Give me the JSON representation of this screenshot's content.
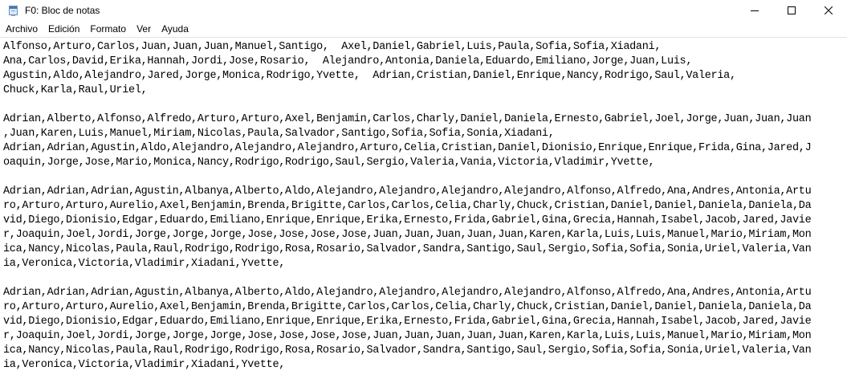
{
  "window": {
    "title": "F0: Bloc de notas",
    "icon": "notepad-icon"
  },
  "menu": [
    "Archivo",
    "Edición",
    "Formato",
    "Ver",
    "Ayuda"
  ],
  "document": {
    "lines": [
      "Alfonso,Arturo,Carlos,Juan,Juan,Juan,Manuel,Santigo,  Axel,Daniel,Gabriel,Luis,Paula,Sofia,Sofia,Xiadani,",
      "Ana,Carlos,David,Erika,Hannah,Jordi,Jose,Rosario,  Alejandro,Antonia,Daniela,Eduardo,Emiliano,Jorge,Juan,Luis,",
      "Agustin,Aldo,Alejandro,Jared,Jorge,Monica,Rodrigo,Yvette,  Adrian,Cristian,Daniel,Enrique,Nancy,Rodrigo,Saul,Valeria,",
      "Chuck,Karla,Raul,Uriel,",
      "",
      "Adrian,Alberto,Alfonso,Alfredo,Arturo,Arturo,Axel,Benjamin,Carlos,Charly,Daniel,Daniela,Ernesto,Gabriel,Joel,Jorge,Juan,Juan,Juan",
      ",Juan,Karen,Luis,Manuel,Miriam,Nicolas,Paula,Salvador,Santigo,Sofia,Sofia,Sonia,Xiadani,",
      "Adrian,Adrian,Agustin,Aldo,Alejandro,Alejandro,Alejandro,Arturo,Celia,Cristian,Daniel,Dionisio,Enrique,Enrique,Frida,Gina,Jared,J",
      "oaquin,Jorge,Jose,Mario,Monica,Nancy,Rodrigo,Rodrigo,Saul,Sergio,Valeria,Vania,Victoria,Vladimir,Yvette,",
      "",
      "Adrian,Adrian,Adrian,Agustin,Albanya,Alberto,Aldo,Alejandro,Alejandro,Alejandro,Alejandro,Alfonso,Alfredo,Ana,Andres,Antonia,Artu",
      "ro,Arturo,Arturo,Aurelio,Axel,Benjamin,Brenda,Brigitte,Carlos,Carlos,Celia,Charly,Chuck,Cristian,Daniel,Daniel,Daniela,Daniela,Da",
      "vid,Diego,Dionisio,Edgar,Eduardo,Emiliano,Enrique,Enrique,Erika,Ernesto,Frida,Gabriel,Gina,Grecia,Hannah,Isabel,Jacob,Jared,Javie",
      "r,Joaquin,Joel,Jordi,Jorge,Jorge,Jorge,Jose,Jose,Jose,Jose,Juan,Juan,Juan,Juan,Juan,Karen,Karla,Luis,Luis,Manuel,Mario,Miriam,Mon",
      "ica,Nancy,Nicolas,Paula,Raul,Rodrigo,Rodrigo,Rosa,Rosario,Salvador,Sandra,Santigo,Saul,Sergio,Sofia,Sofia,Sonia,Uriel,Valeria,Van",
      "ia,Veronica,Victoria,Vladimir,Xiadani,Yvette,",
      "",
      "Adrian,Adrian,Adrian,Agustin,Albanya,Alberto,Aldo,Alejandro,Alejandro,Alejandro,Alejandro,Alfonso,Alfredo,Ana,Andres,Antonia,Artu",
      "ro,Arturo,Arturo,Aurelio,Axel,Benjamin,Brenda,Brigitte,Carlos,Carlos,Celia,Charly,Chuck,Cristian,Daniel,Daniel,Daniela,Daniela,Da",
      "vid,Diego,Dionisio,Edgar,Eduardo,Emiliano,Enrique,Enrique,Erika,Ernesto,Frida,Gabriel,Gina,Grecia,Hannah,Isabel,Jacob,Jared,Javie",
      "r,Joaquin,Joel,Jordi,Jorge,Jorge,Jorge,Jose,Jose,Jose,Jose,Juan,Juan,Juan,Juan,Juan,Karen,Karla,Luis,Luis,Manuel,Mario,Miriam,Mon",
      "ica,Nancy,Nicolas,Paula,Raul,Rodrigo,Rodrigo,Rosa,Rosario,Salvador,Sandra,Santigo,Saul,Sergio,Sofia,Sofia,Sonia,Uriel,Valeria,Van",
      "ia,Veronica,Victoria,Vladimir,Xiadani,Yvette,"
    ]
  }
}
